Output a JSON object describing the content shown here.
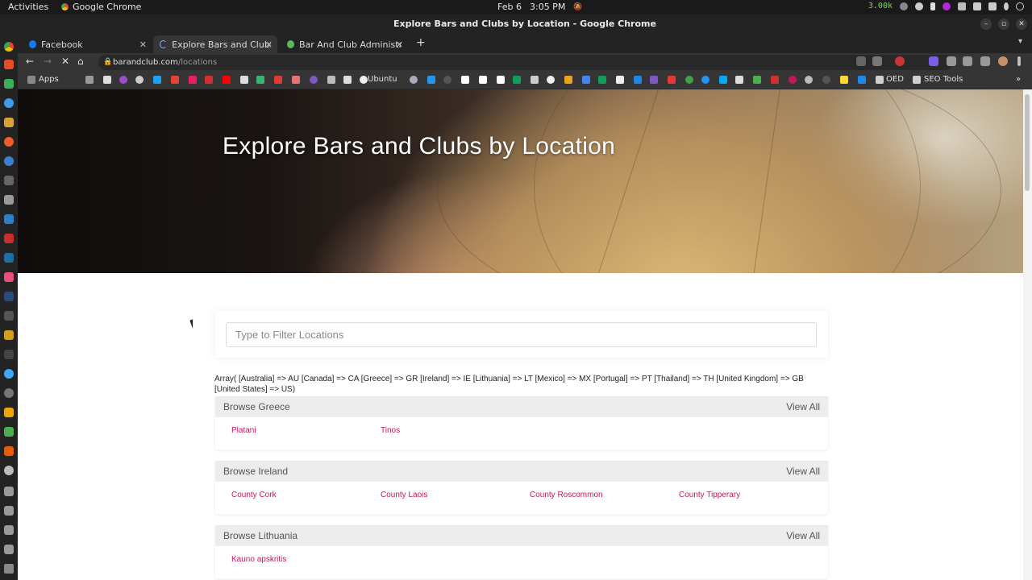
{
  "system": {
    "activities": "Activities",
    "app_name": "Google Chrome",
    "date": "Feb 6",
    "time": "3:05 PM",
    "net_speed": "3.00k"
  },
  "window": {
    "title": "Explore Bars and Clubs by Location - Google Chrome"
  },
  "tabs": [
    {
      "label": "Facebook",
      "icon": "facebook-icon"
    },
    {
      "label": "Explore Bars and Clubs by Location",
      "icon": "loading-icon"
    },
    {
      "label": "Bar And Club Administration",
      "icon": "site-icon"
    }
  ],
  "address": {
    "host": "barandclub.com",
    "path": "/locations"
  },
  "bookmarks": {
    "apps": "Apps",
    "ubuntu": "Ubuntu",
    "oed": "OED",
    "seo": "SEO Tools"
  },
  "hero": {
    "title": "Explore Bars and Clubs by Location"
  },
  "filter": {
    "placeholder": "Type to Filter Locations"
  },
  "debug_text": "Array( [Australia] => AU [Canada] => CA [Greece] => GR [Ireland] => IE [Lithuania] => LT [Mexico] => MX [Portugal] => PT [Thailand] => TH [United Kingdom] => GB [United States] => US)",
  "sections": [
    {
      "heading": "Browse Greece",
      "view_all": "View All",
      "locations": [
        "Platani",
        "Tinos"
      ]
    },
    {
      "heading": "Browse Ireland",
      "view_all": "View All",
      "locations": [
        "County Cork",
        "County Laois",
        "County Roscommon",
        "County Tipperary"
      ]
    },
    {
      "heading": "Browse Lithuania",
      "view_all": "View All",
      "locations": [
        "Kauno apskritis"
      ]
    }
  ],
  "colors": {
    "accent_link": "#c2185b",
    "section_header": "#ececec"
  }
}
